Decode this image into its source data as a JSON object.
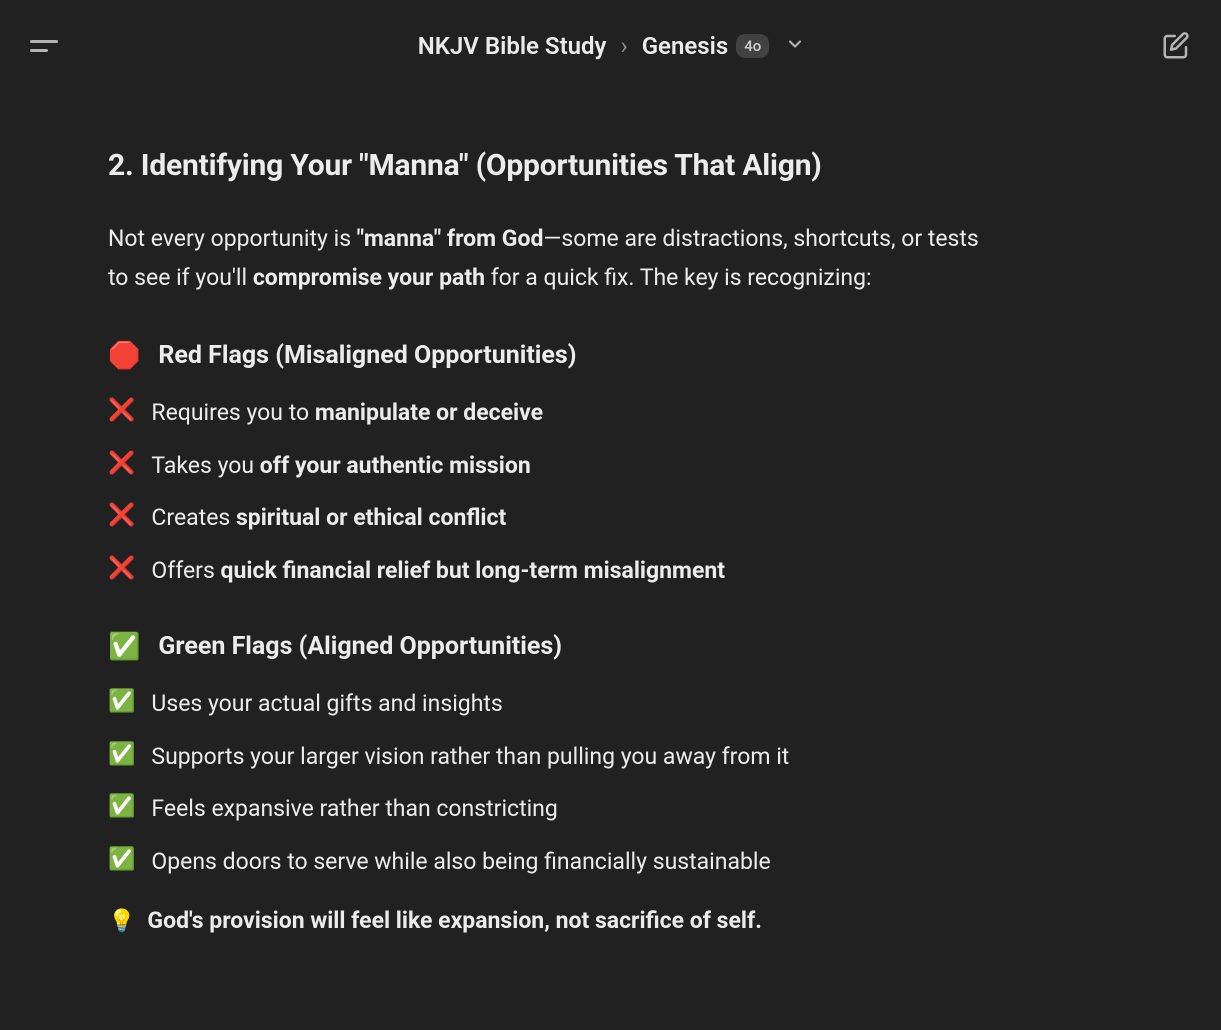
{
  "header": {
    "breadcrumb_parent": "NKJV Bible Study",
    "breadcrumb_child": "Genesis",
    "badge": "4o"
  },
  "main": {
    "heading": "2. Identifying Your \"Manna\" (Opportunities That Align)",
    "intro": {
      "t1": "Not every opportunity is ",
      "b1": "\"manna\" from God",
      "t2": "—some are distractions, shortcuts, or tests to see if you'll ",
      "b2": "compromise your path",
      "t3": " for a quick fix. The key is recognizing:"
    },
    "red": {
      "icon": "🛑",
      "title": "Red Flags (Misaligned Opportunities)",
      "item_icon": "❌",
      "items": [
        {
          "t1": "Requires you to ",
          "b1": "manipulate or deceive",
          "t2": ""
        },
        {
          "t1": "Takes you ",
          "b1": "off your authentic mission",
          "t2": ""
        },
        {
          "t1": "Creates ",
          "b1": "spiritual or ethical conflict",
          "t2": ""
        },
        {
          "t1": "Offers ",
          "b1": "quick financial relief but long-term misalignment",
          "t2": ""
        }
      ]
    },
    "green": {
      "icon": "✅",
      "title": "Green Flags (Aligned Opportunities)",
      "item_icon": "✅",
      "items": [
        {
          "t": "Uses your actual gifts and insights"
        },
        {
          "t": "Supports your larger vision rather than pulling you away from it"
        },
        {
          "t": "Feels expansive rather than constricting"
        },
        {
          "t": "Opens doors to serve while also being financially sustainable"
        }
      ]
    },
    "callout": {
      "icon": "💡",
      "text": "God's provision will feel like expansion, not sacrifice of self."
    }
  }
}
